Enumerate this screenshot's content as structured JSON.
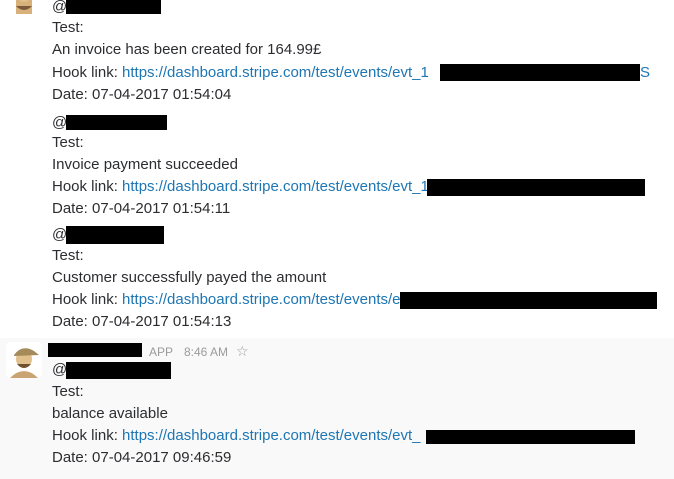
{
  "messages": [
    {
      "mention": "@",
      "test_label": "Test:",
      "body": "An invoice has been created for 164.99£",
      "hook_label": "Hook link:",
      "hook_url": "https://dashboard.stripe.com/test/events/evt_1",
      "hook_url_tail": "S",
      "date": "Date: 07-04-2017 01:54:04"
    },
    {
      "mention": "@",
      "test_label": "Test:",
      "body": "Invoice payment succeeded",
      "hook_label": "Hook link:",
      "hook_url": "https://dashboard.stripe.com/test/events/evt_1",
      "date": "Date: 07-04-2017 01:54:11"
    },
    {
      "mention": "@",
      "test_label": "Test:",
      "body": "Customer successfully payed the amount",
      "hook_label": "Hook link:",
      "hook_url": "https://dashboard.stripe.com/test/events/e",
      "date": "Date: 07-04-2017 01:54:13"
    },
    {
      "app_badge": "APP",
      "time": "8:46 AM",
      "mention": "@",
      "test_label": "Test:",
      "body": "balance available",
      "hook_label": "Hook link:",
      "hook_url": "https://dashboard.stripe.com/test/events/evt_",
      "date": "Date: 07-04-2017 09:46:59"
    }
  ],
  "icons": {
    "avatar": "user-avatar-cap",
    "star": "star-outline-icon"
  },
  "colors": {
    "link": "#1d76b3",
    "text": "#2c2d30",
    "meta": "#9b9b9b",
    "highlight": "#f9f9f9"
  }
}
